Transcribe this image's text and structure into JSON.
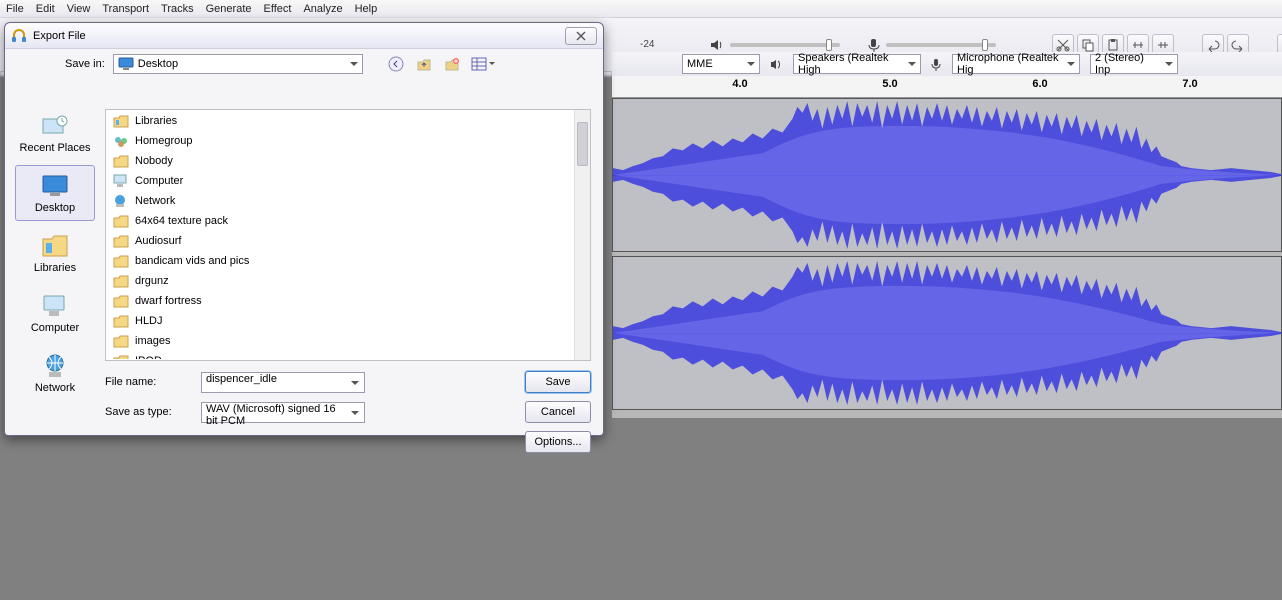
{
  "menu": [
    "File",
    "Edit",
    "View",
    "Transport",
    "Tracks",
    "Generate",
    "Effect",
    "Analyze",
    "Help"
  ],
  "toolbar": {
    "meter_label": "-24",
    "host": "MME",
    "output_device": "Speakers (Realtek High",
    "input_device": "Microphone (Realtek Hig",
    "channels": "2 (Stereo) Inp"
  },
  "ruler": [
    "4.0",
    "5.0",
    "6.0",
    "7.0"
  ],
  "dialog": {
    "title": "Export File",
    "save_in_label": "Save in:",
    "save_in_value": "Desktop",
    "places": [
      "Recent Places",
      "Desktop",
      "Libraries",
      "Computer",
      "Network"
    ],
    "files": [
      "Libraries",
      "Homegroup",
      "Nobody",
      "Computer",
      "Network",
      "64x64 texture pack",
      "Audiosurf",
      "bandicam vids and pics",
      "drgunz",
      "dwarf fortress",
      "HLDJ",
      "images",
      "IPOD"
    ],
    "filename_label": "File name:",
    "filename_value": "dispencer_idle",
    "type_label": "Save as type:",
    "type_value": "WAV (Microsoft) signed 16 bit PCM",
    "save_btn": "Save",
    "cancel_btn": "Cancel",
    "options_btn": "Options..."
  }
}
